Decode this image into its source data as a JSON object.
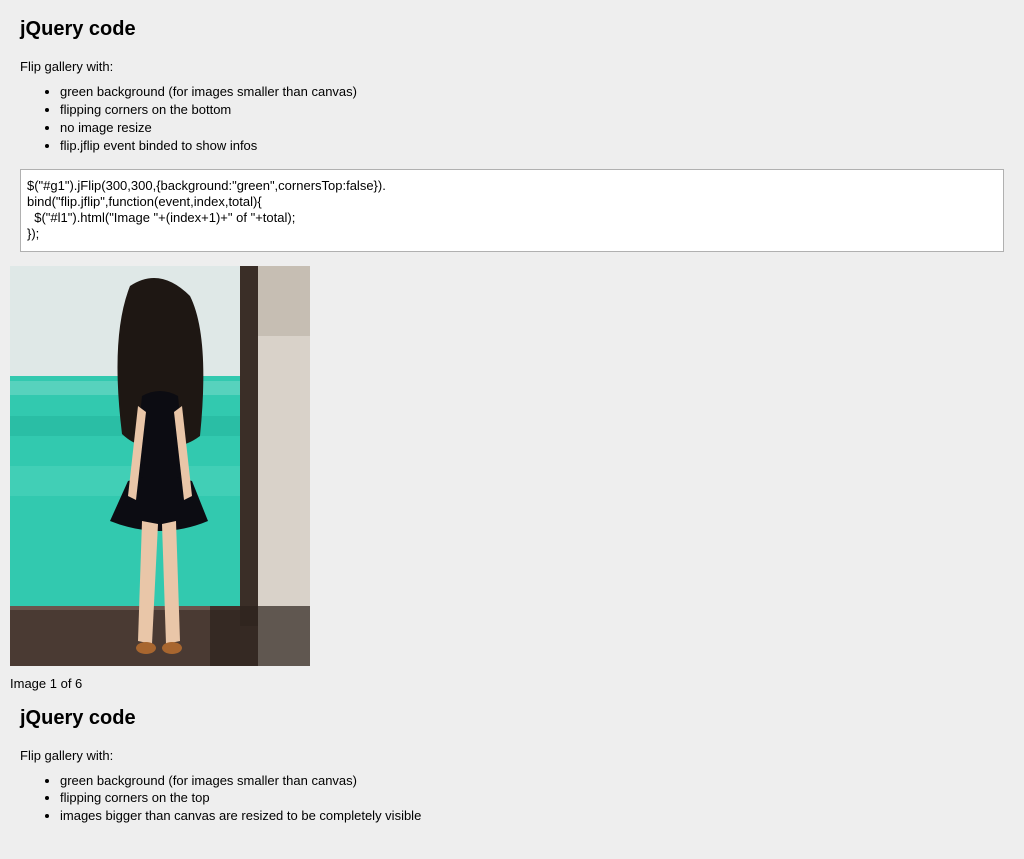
{
  "section1": {
    "heading": "jQuery code",
    "intro": "Flip gallery with:",
    "bullets": [
      "green background (for images smaller than canvas)",
      "flipping corners on the bottom",
      "no image resize",
      "flip.jflip event binded to show infos"
    ],
    "code": "$(\"#g1\").jFlip(300,300,{background:\"green\",cornersTop:false}).\nbind(\"flip.jflip\",function(event,index,total){\n  $(\"#l1\").html(\"Image \"+(index+1)+\" of \"+total);\n});"
  },
  "gallery": {
    "status": "Image 1 of 6"
  },
  "section2": {
    "heading": "jQuery code",
    "intro": "Flip gallery with:",
    "bullets": [
      "green background (for images smaller than canvas)",
      "flipping corners on the top",
      "images bigger than canvas are resized to be completely visible"
    ]
  }
}
